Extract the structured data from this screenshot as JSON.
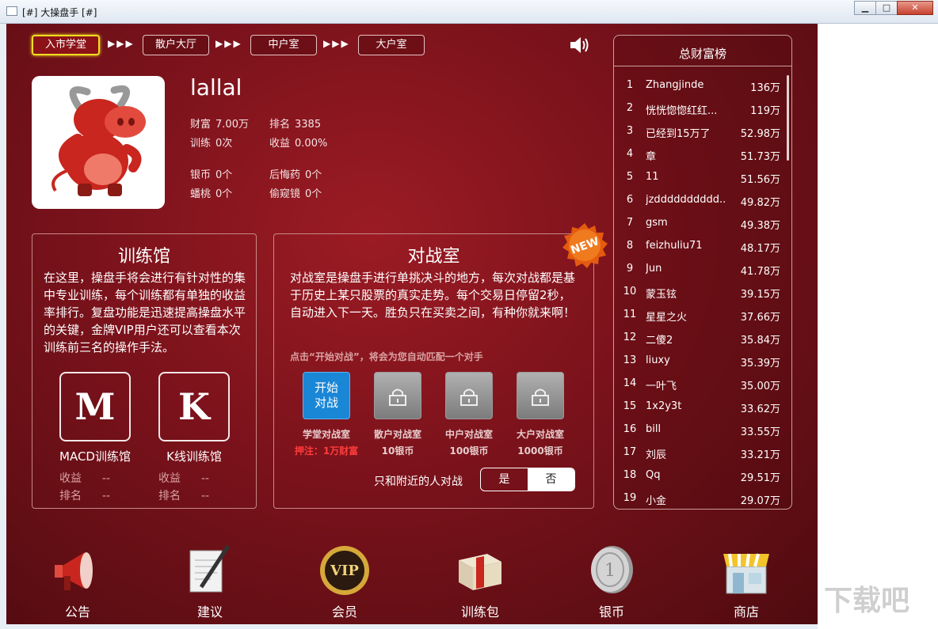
{
  "window": {
    "title": "[#] 大操盘手 [#]",
    "min_glyph": "▁",
    "max_glyph": "□",
    "close_glyph": "✕"
  },
  "nav": {
    "items": [
      {
        "label": "入市学堂",
        "active": true
      },
      {
        "label": "散户大厅",
        "active": false
      },
      {
        "label": "中户室",
        "active": false
      },
      {
        "label": "大户室",
        "active": false
      }
    ],
    "arrow": "▶▶▶"
  },
  "profile": {
    "username": "lallal",
    "wealth_label": "财富",
    "wealth_value": "7.00万",
    "rank_label": "排名",
    "rank_value": "3385",
    "train_label": "训练",
    "train_value": "0次",
    "profit_label": "收益",
    "profit_value": "0.00%",
    "silver_label": "银币",
    "silver_value": "0个",
    "regret_label": "后悔药",
    "regret_value": "0个",
    "peach_label": "蟠桃",
    "peach_value": "0个",
    "peek_label": "偷窥镜",
    "peek_value": "0个"
  },
  "training": {
    "title": "训练馆",
    "desc": "在这里，操盘手将会进行有针对性的集中专业训练，每个训练都有单独的收益率排行。复盘功能是迅速提高操盘水平的关键，金牌VIP用户还可以查看本次训练前三名的操作手法。",
    "items": [
      {
        "glyph": "M",
        "label": "MACD训练馆",
        "profit_label": "收益",
        "profit_value": "--",
        "rank_label": "排名",
        "rank_value": "--"
      },
      {
        "glyph": "K",
        "label": "K线训练馆",
        "profit_label": "收益",
        "profit_value": "--",
        "rank_label": "排名",
        "rank_value": "--"
      }
    ]
  },
  "battle": {
    "title": "对战室",
    "badge": "NEW",
    "desc": "对战室是操盘手进行单挑决斗的地方，每次对战都是基于历史上某只股票的真实走势。每个交易日停留2秒，自动进入下一天。胜负只在买卖之间，有种你就来啊！",
    "hint": "点击“开始对战”，将会为您自动匹配一个对手",
    "start_line1": "开始",
    "start_line2": "对战",
    "rooms": [
      {
        "name": "学堂对战室",
        "cost": "押注：1万财富",
        "locked": false
      },
      {
        "name": "散户对战室",
        "cost": "10银币",
        "locked": true
      },
      {
        "name": "中户对战室",
        "cost": "100银币",
        "locked": true
      },
      {
        "name": "大户对战室",
        "cost": "1000银币",
        "locked": true
      }
    ],
    "nearby_label": "只和附近的人对战",
    "yes": "是",
    "no": "否"
  },
  "leaderboard": {
    "title": "总财富榜",
    "rows": [
      {
        "rank": "1",
        "name": "Zhangjinde",
        "value": "136万"
      },
      {
        "rank": "2",
        "name": "恍恍惚惚红红...",
        "value": "119万"
      },
      {
        "rank": "3",
        "name": "已经到15万了",
        "value": "52.98万"
      },
      {
        "rank": "4",
        "name": "章",
        "value": "51.73万"
      },
      {
        "rank": "5",
        "name": "11",
        "value": "51.56万"
      },
      {
        "rank": "6",
        "name": "jzdddddddddd...",
        "value": "49.82万"
      },
      {
        "rank": "7",
        "name": "gsm",
        "value": "49.38万"
      },
      {
        "rank": "8",
        "name": "feizhuliu71",
        "value": "48.17万"
      },
      {
        "rank": "9",
        "name": "Jun",
        "value": "41.78万"
      },
      {
        "rank": "10",
        "name": "蒙玉铉",
        "value": "39.15万"
      },
      {
        "rank": "11",
        "name": "星星之火",
        "value": "37.66万"
      },
      {
        "rank": "12",
        "name": "二傻2",
        "value": "35.84万"
      },
      {
        "rank": "13",
        "name": "liuxy",
        "value": "35.39万"
      },
      {
        "rank": "14",
        "name": "一叶飞",
        "value": "35.00万"
      },
      {
        "rank": "15",
        "name": "1x2y3t",
        "value": "33.62万"
      },
      {
        "rank": "16",
        "name": "bill",
        "value": "33.55万"
      },
      {
        "rank": "17",
        "name": "刘辰",
        "value": "33.21万"
      },
      {
        "rank": "18",
        "name": "Qq",
        "value": "29.51万"
      },
      {
        "rank": "19",
        "name": "小金",
        "value": "29.07万"
      }
    ]
  },
  "bottom": {
    "items": [
      {
        "label": "公告",
        "icon": "megaphone-icon"
      },
      {
        "label": "建议",
        "icon": "note-pen-icon"
      },
      {
        "label": "会员",
        "icon": "vip-icon"
      },
      {
        "label": "训练包",
        "icon": "gift-box-icon"
      },
      {
        "label": "银币",
        "icon": "silver-coin-icon"
      },
      {
        "label": "商店",
        "icon": "shop-icon"
      }
    ],
    "vip_text": "VIP",
    "coin_text": "1"
  },
  "watermark": "下载吧",
  "colors": {
    "background_red": "#7a121b",
    "active_nav_border": "#f2de1f",
    "start_button_blue": "#1a86d6",
    "stake_red": "#ff3c3c"
  }
}
